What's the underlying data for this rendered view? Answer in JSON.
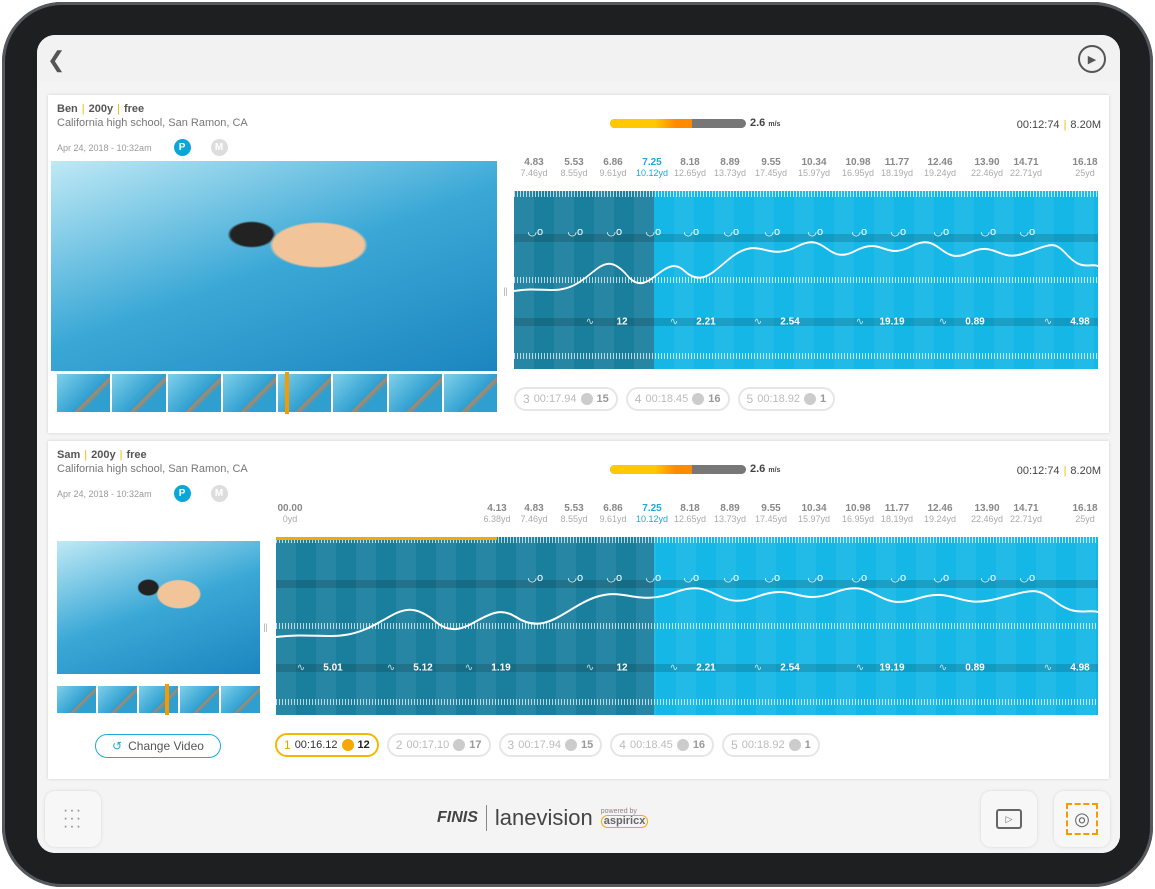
{
  "topbar": {
    "back_icon": "chevron-left-icon",
    "play_icon": "play-circle-icon"
  },
  "colors": {
    "accent": "#1ea9d8",
    "highlight": "#f5b700",
    "dark_segment": "#1a7f9d",
    "light_segment": "#14b7e6"
  },
  "panels": [
    {
      "swimmer": "Ben",
      "distance": "200y",
      "stroke": "free",
      "location": "California high school, San Ramon, CA",
      "date": "Apr 24, 2018 - 10:32am",
      "badge_p": "P",
      "badge_m": "M",
      "speed": "2.6",
      "speed_unit": "m/s",
      "speed_fraction": 0.6,
      "elapsed": "00:12:74",
      "distance_total": "8.20M",
      "splits": [
        [
          "4.83",
          "7.46yd"
        ],
        [
          "5.53",
          "8.55yd"
        ],
        [
          "6.86",
          "9.61yd"
        ],
        [
          "7.25",
          "10.12yd"
        ],
        [
          "8.18",
          "12.65yd"
        ],
        [
          "8.89",
          "13.73yd"
        ],
        [
          "9.55",
          "17.45yd"
        ],
        [
          "10.34",
          "15.97yd"
        ],
        [
          "10.98",
          "16.95yd"
        ],
        [
          "11.77",
          "18.19yd"
        ],
        [
          "12.46",
          "19.24yd"
        ],
        [
          "13.90",
          "22.46yd"
        ],
        [
          "14.71",
          "22.71yd"
        ],
        [
          "16.18",
          "25yd"
        ]
      ],
      "highlight_split": "7.25",
      "metrics": [
        [
          "12",
          "stroke-count-icon"
        ],
        [
          "2.21",
          "turn-icon"
        ],
        [
          "2.54",
          "underwater-icon"
        ],
        [
          "19.19",
          "15m-icon"
        ],
        [
          "0.89",
          "stroke-rate-icon"
        ],
        [
          "4.98",
          "finish-turn-icon"
        ]
      ],
      "laps": [
        {
          "n": "3",
          "time": "00:17.94",
          "count": "15"
        },
        {
          "n": "4",
          "time": "00:18.45",
          "count": "16"
        },
        {
          "n": "5",
          "time": "00:18.92",
          "count": "1"
        }
      ]
    },
    {
      "swimmer": "Sam",
      "distance": "200y",
      "stroke": "free",
      "location": "California high school, San Ramon, CA",
      "date": "Apr 24, 2018 - 10:32am",
      "badge_p": "P",
      "badge_m": "M",
      "speed": "2.6",
      "speed_unit": "m/s",
      "speed_fraction": 0.6,
      "elapsed": "00:12:74",
      "distance_total": "8.20M",
      "splits": [
        [
          "00.00",
          "0yd"
        ],
        [
          "4.13",
          "6.38yd"
        ],
        [
          "4.83",
          "7.46yd"
        ],
        [
          "5.53",
          "8.55yd"
        ],
        [
          "6.86",
          "9.61yd"
        ],
        [
          "7.25",
          "10.12yd"
        ],
        [
          "8.18",
          "12.65yd"
        ],
        [
          "8.89",
          "13.73yd"
        ],
        [
          "9.55",
          "17.45yd"
        ],
        [
          "10.34",
          "15.97yd"
        ],
        [
          "10.98",
          "16.95yd"
        ],
        [
          "11.77",
          "18.19yd"
        ],
        [
          "12.46",
          "19.24yd"
        ],
        [
          "13.90",
          "22.46yd"
        ],
        [
          "14.71",
          "22.71yd"
        ],
        [
          "16.18",
          "25yd"
        ]
      ],
      "highlight_split": "7.25",
      "metrics": [
        [
          "5.01",
          "start-icon"
        ],
        [
          "5.12",
          "underwater-icon"
        ],
        [
          "1.19",
          "breakout-icon"
        ],
        [
          "12",
          "stroke-count-icon"
        ],
        [
          "2.21",
          "turn-icon"
        ],
        [
          "2.54",
          "underwater-icon"
        ],
        [
          "19.19",
          "15m-icon"
        ],
        [
          "0.89",
          "stroke-rate-icon"
        ],
        [
          "4.98",
          "finish-turn-icon"
        ]
      ],
      "laps": [
        {
          "n": "1",
          "time": "00:16.12",
          "count": "12",
          "active": true
        },
        {
          "n": "2",
          "time": "00:17.10",
          "count": "17"
        },
        {
          "n": "3",
          "time": "00:17.94",
          "count": "15"
        },
        {
          "n": "4",
          "time": "00:18.45",
          "count": "16"
        },
        {
          "n": "5",
          "time": "00:18.92",
          "count": "1"
        }
      ],
      "change_video": "Change Video"
    }
  ],
  "bottom": {
    "grid_icon": "grid-icon",
    "brand": "FINIS",
    "product": "lanevision",
    "powered_by": "powered by",
    "partner": "aspiricx",
    "add_video_icon": "add-video-icon",
    "capture_icon": "camera-focus-icon"
  }
}
